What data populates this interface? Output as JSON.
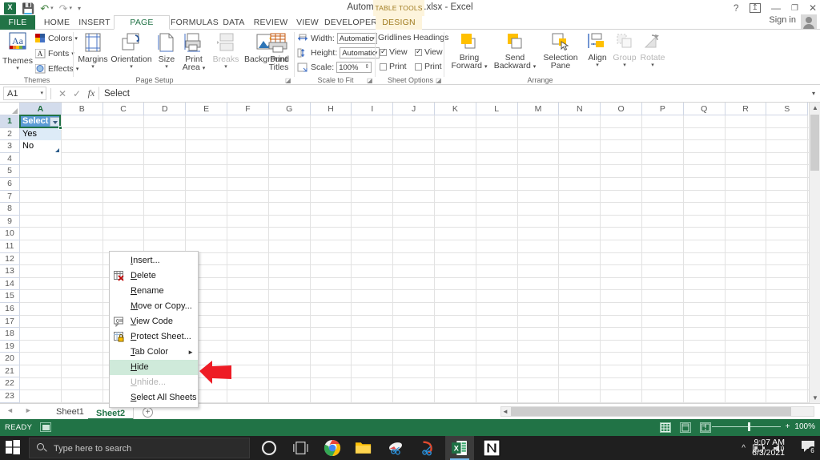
{
  "window": {
    "title": "Automation tutorial.xlsx - Excel",
    "contextual_tab_group": "TABLE TOOLS",
    "sign_in": "Sign in",
    "buttons": {
      "help": "?",
      "ribbon_display": "ribbon-display-options",
      "minimize": "—",
      "restore": "restore",
      "close": "✕"
    }
  },
  "quick_access": [
    {
      "name": "save",
      "glyph": "💾"
    },
    {
      "name": "undo",
      "glyph": "↶"
    },
    {
      "name": "redo",
      "glyph": "↷"
    },
    {
      "name": "customize",
      "glyph": "▾"
    }
  ],
  "ribbon": {
    "tabs": [
      {
        "label": "FILE",
        "state": "file"
      },
      {
        "label": "HOME",
        "state": "normal"
      },
      {
        "label": "INSERT",
        "state": "normal"
      },
      {
        "label": "PAGE LAYOUT",
        "state": "active"
      },
      {
        "label": "FORMULAS",
        "state": "normal"
      },
      {
        "label": "DATA",
        "state": "normal"
      },
      {
        "label": "REVIEW",
        "state": "normal"
      },
      {
        "label": "VIEW",
        "state": "normal"
      },
      {
        "label": "DEVELOPER",
        "state": "normal"
      },
      {
        "label": "DESIGN",
        "state": "contextual"
      }
    ],
    "groups": [
      {
        "name": "themes",
        "label": "Themes",
        "commands": [
          {
            "label": "Themes",
            "dropdown": true
          },
          {
            "label": "Colors",
            "dropdown": true
          },
          {
            "label": "Fonts",
            "dropdown": true
          },
          {
            "label": "Effects",
            "dropdown": true
          }
        ]
      },
      {
        "name": "page-setup",
        "label": "Page Setup",
        "commands": [
          {
            "label": "Margins",
            "dropdown": true,
            "enabled": true
          },
          {
            "label": "Orientation",
            "dropdown": true,
            "enabled": true
          },
          {
            "label": "Size",
            "dropdown": true,
            "enabled": true
          },
          {
            "label": "Print\nArea",
            "dropdown": true,
            "enabled": true
          },
          {
            "label": "Breaks",
            "dropdown": true,
            "enabled": false
          },
          {
            "label": "Background",
            "dropdown": false,
            "enabled": true
          },
          {
            "label": "Print\nTitles",
            "dropdown": false,
            "enabled": true
          }
        ]
      },
      {
        "name": "scale-to-fit",
        "label": "Scale to Fit",
        "fields": [
          {
            "label": "Width:",
            "value": "Automatic"
          },
          {
            "label": "Height:",
            "value": "Automatic"
          },
          {
            "label": "Scale:",
            "value": "100%"
          }
        ]
      },
      {
        "name": "sheet-options",
        "label": "Sheet Options",
        "columns": [
          {
            "header": "Gridlines",
            "options": [
              {
                "label": "View",
                "checked": true
              },
              {
                "label": "Print",
                "checked": false
              }
            ]
          },
          {
            "header": "Headings",
            "options": [
              {
                "label": "View",
                "checked": true
              },
              {
                "label": "Print",
                "checked": false
              }
            ]
          }
        ]
      },
      {
        "name": "arrange",
        "label": "Arrange",
        "commands": [
          {
            "label": "Bring\nForward",
            "dropdown": true,
            "enabled": true
          },
          {
            "label": "Send\nBackward",
            "dropdown": true,
            "enabled": true
          },
          {
            "label": "Selection\nPane",
            "dropdown": false,
            "enabled": true
          },
          {
            "label": "Align",
            "dropdown": true,
            "enabled": true
          },
          {
            "label": "Group",
            "dropdown": true,
            "enabled": false
          },
          {
            "label": "Rotate",
            "dropdown": true,
            "enabled": false
          }
        ]
      }
    ]
  },
  "formula_bar": {
    "name_box": "A1",
    "cancel": "✕",
    "enter": "✓",
    "function_label": "fx",
    "value": "Select",
    "expand": "▾"
  },
  "grid": {
    "columns": [
      "A",
      "B",
      "C",
      "D",
      "E",
      "F",
      "G",
      "H",
      "I",
      "J",
      "K",
      "L",
      "M",
      "N",
      "O",
      "P",
      "Q",
      "R",
      "S"
    ],
    "rows": [
      1,
      2,
      3,
      4,
      5,
      6,
      7,
      8,
      9,
      10,
      11,
      12,
      13,
      14,
      15,
      16,
      17,
      18,
      19,
      20,
      21,
      22,
      23
    ],
    "selected_cell": "A1",
    "cells": [
      {
        "ref": "A1",
        "col": 0,
        "row": 1,
        "value": "Select",
        "style": "header",
        "filter_button": true
      },
      {
        "ref": "A2",
        "col": 0,
        "row": 2,
        "value": "Yes",
        "style": "banded"
      },
      {
        "ref": "A3",
        "col": 0,
        "row": 3,
        "value": "No",
        "style": "plain"
      }
    ]
  },
  "context_menu": {
    "items": [
      {
        "label": "Insert...",
        "icon": null,
        "state": "normal",
        "mnemonic": "I"
      },
      {
        "label": "Delete",
        "icon": "delete-sheet-icon",
        "state": "normal",
        "mnemonic": "D"
      },
      {
        "label": "Rename",
        "icon": null,
        "state": "normal",
        "mnemonic": "R"
      },
      {
        "label": "Move or Copy...",
        "icon": null,
        "state": "normal",
        "mnemonic": "M"
      },
      {
        "label": "View Code",
        "icon": "view-code-icon",
        "state": "normal",
        "mnemonic": "V"
      },
      {
        "label": "Protect Sheet...",
        "icon": "protect-sheet-icon",
        "state": "normal",
        "mnemonic": "P"
      },
      {
        "label": "Tab Color",
        "icon": null,
        "state": "submenu",
        "mnemonic": "T"
      },
      {
        "label": "Hide",
        "icon": null,
        "state": "highlighted",
        "mnemonic": "H"
      },
      {
        "label": "Unhide...",
        "icon": null,
        "state": "disabled",
        "mnemonic": "U"
      },
      {
        "label": "Select All Sheets",
        "icon": null,
        "state": "normal",
        "mnemonic": "S"
      }
    ]
  },
  "annotation": {
    "name": "red-arrow",
    "points_to": "Hide",
    "color": "#ee1c25"
  },
  "sheet_tabs": {
    "nav": {
      "prev": "◄",
      "next": "►"
    },
    "tabs": [
      {
        "label": "Sheet1",
        "active": false
      },
      {
        "label": "Sheet2",
        "active": true
      }
    ],
    "add_label": "+"
  },
  "status_bar": {
    "mode": "READY",
    "macro_record": "record-macro-icon",
    "views": [
      {
        "name": "normal-view",
        "active": true
      },
      {
        "name": "page-layout-view",
        "active": false
      },
      {
        "name": "page-break-preview",
        "active": false
      }
    ],
    "zoom_out": "−",
    "zoom_in": "+",
    "zoom_level": "100%"
  },
  "taskbar": {
    "start": "start-button",
    "search_placeholder": "Type here to search",
    "items": [
      {
        "name": "cortana-icon"
      },
      {
        "name": "task-view-icon"
      },
      {
        "name": "chrome-icon"
      },
      {
        "name": "file-explorer-icon"
      },
      {
        "name": "snip-sketch-icon"
      },
      {
        "name": "snipping-tool-icon"
      },
      {
        "name": "excel-icon",
        "active": true
      },
      {
        "name": "notion-icon"
      }
    ],
    "tray": {
      "expand": "^",
      "battery": "battery-icon",
      "volume": "volume-icon"
    },
    "clock": {
      "time": "9:07 AM",
      "date": "6/3/2021"
    },
    "notifications": {
      "icon": "action-center-icon",
      "count": "6"
    }
  }
}
